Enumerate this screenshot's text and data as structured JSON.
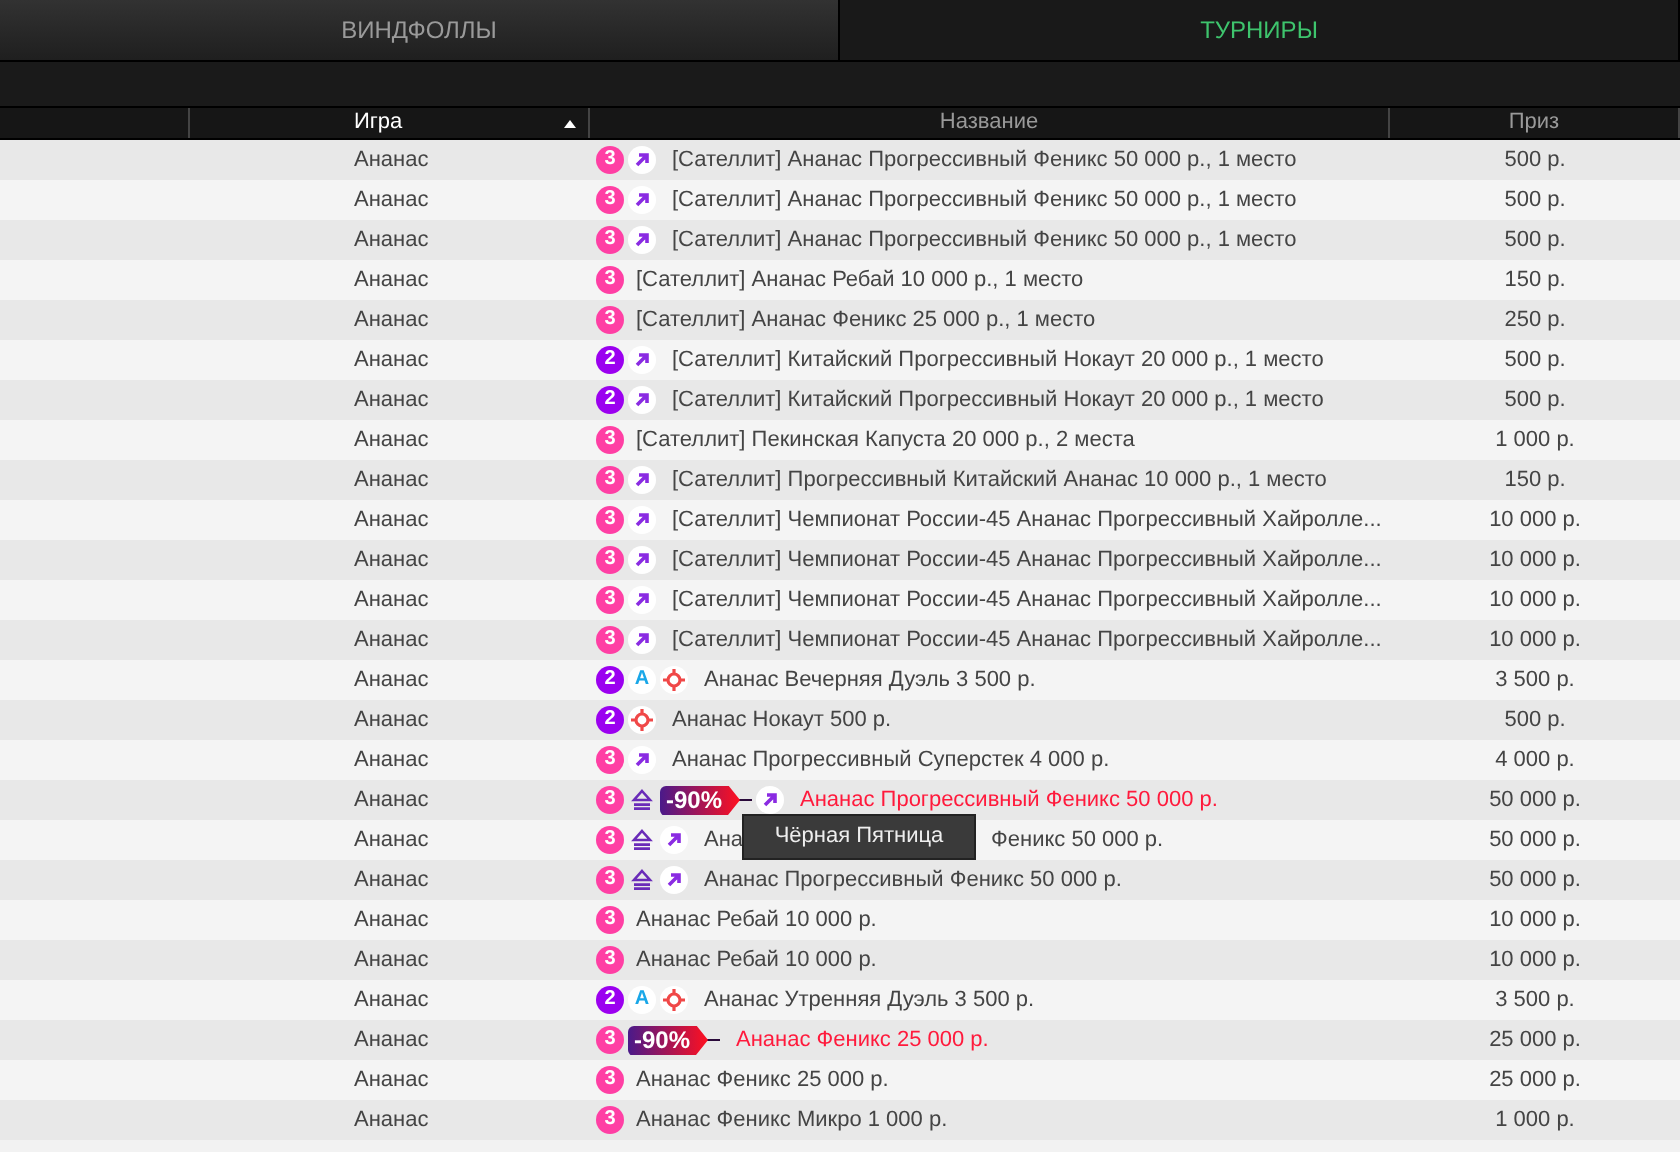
{
  "tabs": [
    {
      "label": "ВИНДФОЛЛЫ",
      "selected": false
    },
    {
      "label": "ТУРНИРЫ",
      "selected": true
    }
  ],
  "table": {
    "columns": [
      {
        "label": "Игра",
        "sorted": true
      },
      {
        "label": "Название",
        "sorted": false
      },
      {
        "label": "Приз",
        "sorted": false
      }
    ],
    "rows": [
      {
        "game": "Ананас",
        "level": "3",
        "color": "#ff3fa4",
        "icons": [
          {
            "kind": "arrow"
          }
        ],
        "name": "[Сателлит] Ананас Прогрессивный Феникс 50 000 р., 1 место",
        "promo": false,
        "prize": "500 р."
      },
      {
        "game": "Ананас",
        "level": "3",
        "color": "#ff3fa4",
        "icons": [
          {
            "kind": "arrow"
          }
        ],
        "name": "[Сателлит] Ананас Прогрессивный Феникс 50 000 р., 1 место",
        "promo": false,
        "prize": "500 р."
      },
      {
        "game": "Ананас",
        "level": "3",
        "color": "#ff3fa4",
        "icons": [
          {
            "kind": "arrow"
          }
        ],
        "name": "[Сателлит] Ананас Прогрессивный Феникс 50 000 р., 1 место",
        "promo": false,
        "prize": "500 р."
      },
      {
        "game": "Ананас",
        "level": "3",
        "color": "#ff3fa4",
        "name": "[Сателлит] Ананас Ребай 10 000 р., 1 место",
        "promo": false,
        "prize": "150 р."
      },
      {
        "game": "Ананас",
        "level": "3",
        "color": "#ff3fa4",
        "name": "[Сателлит] Ананас Феникс 25 000 р., 1 место",
        "promo": false,
        "prize": "250 р."
      },
      {
        "game": "Ананас",
        "level": "2",
        "color": "#9b00f0",
        "icons": [
          {
            "kind": "arrow"
          }
        ],
        "name": "[Сателлит] Китайский Прогрессивный Нокаут 20 000 р., 1 место",
        "promo": false,
        "prize": "500 р."
      },
      {
        "game": "Ананас",
        "level": "2",
        "color": "#9b00f0",
        "icons": [
          {
            "kind": "arrow"
          }
        ],
        "name": "[Сателлит] Китайский Прогрессивный Нокаут 20 000 р., 1 место",
        "promo": false,
        "prize": "500 р."
      },
      {
        "game": "Ананас",
        "level": "3",
        "color": "#ff3fa4",
        "name": "[Сателлит] Пекинская Капуста 20 000 р., 2 места",
        "promo": false,
        "prize": "1 000 р."
      },
      {
        "game": "Ананас",
        "level": "3",
        "color": "#ff3fa4",
        "icons": [
          {
            "kind": "arrow"
          }
        ],
        "name": "[Сателлит] Прогрессивный Китайский Ананас 10 000 р., 1 место",
        "promo": false,
        "prize": "150 р."
      },
      {
        "game": "Ананас",
        "level": "3",
        "color": "#ff3fa4",
        "icons": [
          {
            "kind": "arrow"
          }
        ],
        "name": "[Сателлит] Чемпионат России-45 Ананас Прогрессивный Хайролле...",
        "promo": false,
        "prize": "10 000 р."
      },
      {
        "game": "Ананас",
        "level": "3",
        "color": "#ff3fa4",
        "icons": [
          {
            "kind": "arrow"
          }
        ],
        "name": "[Сателлит] Чемпионат России-45 Ананас Прогрессивный Хайролле...",
        "promo": false,
        "prize": "10 000 р."
      },
      {
        "game": "Ананас",
        "level": "3",
        "color": "#ff3fa4",
        "icons": [
          {
            "kind": "arrow"
          }
        ],
        "name": "[Сателлит] Чемпионат России-45 Ананас Прогрессивный Хайролле...",
        "promo": false,
        "prize": "10 000 р."
      },
      {
        "game": "Ананас",
        "level": "3",
        "color": "#ff3fa4",
        "icons": [
          {
            "kind": "arrow"
          }
        ],
        "name": "[Сателлит] Чемпионат России-45 Ананас Прогрессивный Хайролле...",
        "promo": false,
        "prize": "10 000 р."
      },
      {
        "game": "Ананас",
        "level": "2",
        "color": "#9b00f0",
        "icons": [
          {
            "kind": "letter",
            "text": "A"
          },
          {
            "kind": "target"
          }
        ],
        "name": "Ананас Вечерняя Дуэль 3 500 р.",
        "promo": false,
        "prize": "3 500 р."
      },
      {
        "game": "Ананас",
        "level": "2",
        "color": "#9b00f0",
        "icons": [
          {
            "kind": "target"
          }
        ],
        "name": "Ананас Нокаут 500 р.",
        "promo": false,
        "prize": "500 р."
      },
      {
        "game": "Ананас",
        "level": "3",
        "color": "#ff3fa4",
        "icons": [
          {
            "kind": "arrow"
          }
        ],
        "name": "Ананас Прогрессивный Суперстек 4 000 р.",
        "promo": false,
        "prize": "4 000 р."
      },
      {
        "game": "Ананас",
        "level": "3",
        "color": "#ff3fa4",
        "icons": [
          {
            "kind": "eject"
          },
          {
            "kind": "discount",
            "text": "-90%"
          },
          {
            "kind": "arrow"
          }
        ],
        "name": "Ананас Прогрессивный Феникс 50 000 р.",
        "promo": true,
        "prize": "50 000 р."
      },
      {
        "game": "Ананас",
        "level": "3",
        "color": "#ff3fa4",
        "icons": [
          {
            "kind": "eject"
          },
          {
            "kind": "arrow"
          }
        ],
        "name": "Ана",
        "tail": "Феникс 50 000 р.",
        "promo": false,
        "prize": "50 000 р."
      },
      {
        "game": "Ананас",
        "level": "3",
        "color": "#ff3fa4",
        "icons": [
          {
            "kind": "eject"
          },
          {
            "kind": "arrow"
          }
        ],
        "name": "Ананас Прогрессивный Феникс 50 000 р.",
        "promo": false,
        "prize": "50 000 р."
      },
      {
        "game": "Ананас",
        "level": "3",
        "color": "#ff3fa4",
        "name": "Ананас Ребай 10 000 р.",
        "promo": false,
        "prize": "10 000 р."
      },
      {
        "game": "Ананас",
        "level": "3",
        "color": "#ff3fa4",
        "name": "Ананас Ребай 10 000 р.",
        "promo": false,
        "prize": "10 000 р."
      },
      {
        "game": "Ананас",
        "level": "2",
        "color": "#9b00f0",
        "icons": [
          {
            "kind": "letter",
            "text": "A"
          },
          {
            "kind": "target"
          }
        ],
        "name": "Ананас Утренняя Дуэль 3 500 р.",
        "promo": false,
        "prize": "3 500 р."
      },
      {
        "game": "Ананас",
        "level": "3",
        "color": "#ff3fa4",
        "icons": [
          {
            "kind": "discount",
            "text": "-90%"
          }
        ],
        "name": "Ананас Феникс 25 000 р.",
        "promo": true,
        "prize": "25 000 р."
      },
      {
        "game": "Ананас",
        "level": "3",
        "color": "#ff3fa4",
        "name": "Ананас Феникс 25 000 р.",
        "promo": false,
        "prize": "25 000 р."
      },
      {
        "game": "Ананас",
        "level": "3",
        "color": "#ff3fa4",
        "name": "Ананас Феникс Микро 1 000 р.",
        "promo": false,
        "prize": "1 000 р."
      }
    ]
  },
  "tooltip": {
    "text": "Чёрная Пятница"
  }
}
